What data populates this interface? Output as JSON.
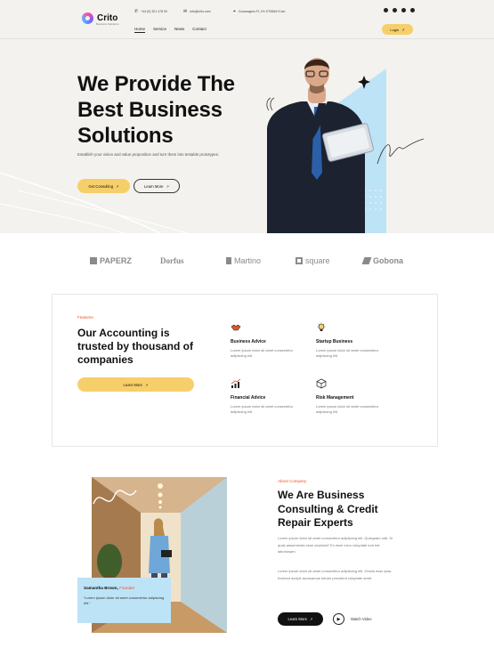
{
  "header": {
    "logo_text": "Crito",
    "logo_tagline": "Business Solutions",
    "phone": "+44 (0) 321 478 00",
    "email": "info@crito.com",
    "address": "Cowaragem Ft, 1% ST0554+Com",
    "nav": [
      "Home",
      "Service",
      "News",
      "Contact"
    ],
    "login_label": "Login"
  },
  "hero": {
    "title": "We Provide The Best Business Solutions",
    "description": "Establish your vision and value proposition and turn them into testable prototypes.",
    "primary_btn": "Get Consulting",
    "secondary_btn": "Learn More"
  },
  "brands": [
    "PAPERZ",
    "Dorfus",
    "Martino",
    "square",
    "Gobona"
  ],
  "features": {
    "eyebrow": "Features",
    "title": "Our Accounting is trusted by thousand of companies",
    "button": "Learn More",
    "items": [
      {
        "title": "Business Advice",
        "text": "Lorem ipsum dolor sit amet consectetur adipiscing elit."
      },
      {
        "title": "Startup Business",
        "text": "Lorem ipsum dolor sit amet consectetur adipiscing elit."
      },
      {
        "title": "Financial Advice",
        "text": "Lorem ipsum dolor sit amet consectetur adipiscing elit."
      },
      {
        "title": "Risk Management",
        "text": "Lorem ipsum dolor sit amet consectetur adipiscing elit."
      }
    ]
  },
  "about": {
    "eyebrow": "About Company",
    "title": "We Are Business Consulting & Credit Repair Experts",
    "paragraph1": "Lorem ipsum dolor sit amet consectetur adipiscing elit. Quisquam odit. Si quas assumenda esse cicuidad? Ex esse error voluptate iure est laboriosam.",
    "paragraph2": "Lorem ipsum dolor sit amet consectetur adipiscing elit. Omnis esse ipsa. Incidunt accipit accusamus harum provident voluptate amet.",
    "button": "Learn More",
    "video_label": "Watch Video",
    "quote": {
      "name": "Samantha Brown,",
      "role": "Founder",
      "text": "“Lorem ipsum dolor sit amet consectetur adipiscing elit.”"
    }
  },
  "colors": {
    "accent_yellow": "#f7cf6a",
    "accent_blue": "#bde3f7",
    "eyebrow_orange": "#e8552a"
  }
}
